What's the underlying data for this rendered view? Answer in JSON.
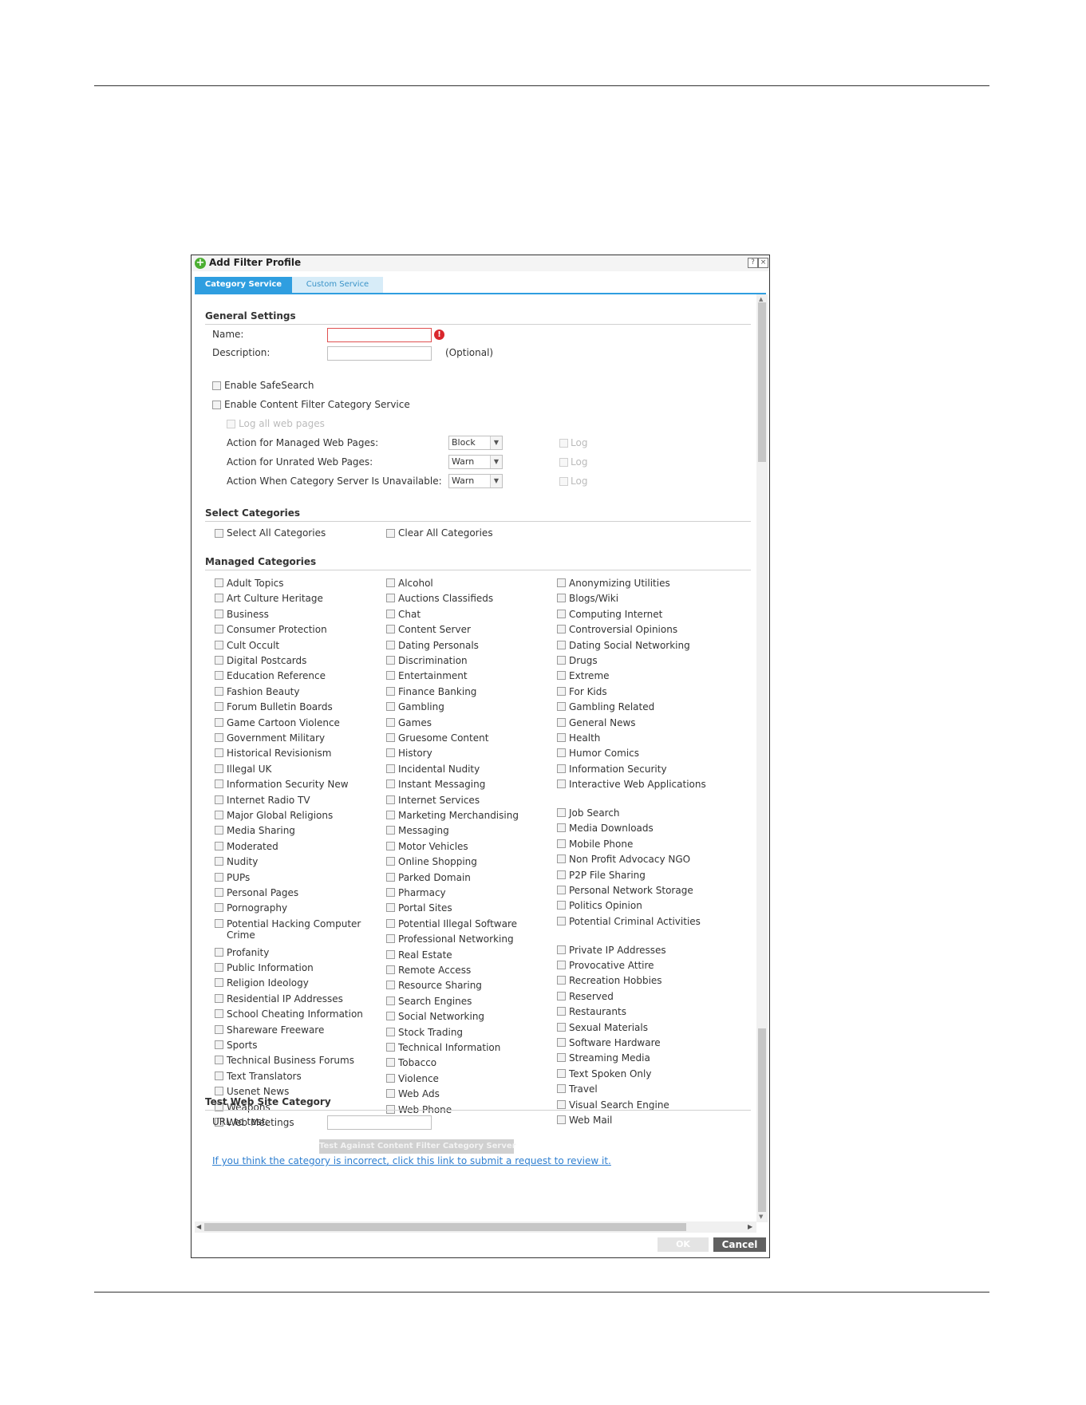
{
  "dialog": {
    "title": "Add Filter Profile",
    "help_glyph": "?",
    "close_glyph": "×",
    "tabs": [
      {
        "label": "Category Service",
        "active": true
      },
      {
        "label": "Custom Service",
        "active": false
      }
    ]
  },
  "general": {
    "heading": "General Settings",
    "name_label": "Name:",
    "name_value": "",
    "error_glyph": "!",
    "description_label": "Description:",
    "description_value": "",
    "optional_text": "(Optional)",
    "enable_safesearch": "Enable SafeSearch",
    "enable_content_filter": "Enable Content Filter Category Service",
    "log_all": "Log all web pages",
    "actions": [
      {
        "label": "Action for Managed Web Pages:",
        "value": "Block",
        "log": "Log"
      },
      {
        "label": "Action for Unrated Web Pages:",
        "value": "Warn",
        "log": "Log"
      },
      {
        "label": "Action When Category Server Is Unavailable:",
        "value": "Warn",
        "log": "Log"
      }
    ]
  },
  "select_categories": {
    "heading": "Select Categories",
    "select_all": "Select All Categories",
    "clear_all": "Clear All Categories"
  },
  "managed": {
    "heading": "Managed Categories",
    "columns": [
      [
        "Adult Topics",
        "Art Culture Heritage",
        "Business",
        "Consumer Protection",
        "Cult Occult",
        "Digital Postcards",
        "Education Reference",
        "Fashion Beauty",
        "Forum Bulletin Boards",
        "Game Cartoon Violence",
        "Government Military",
        "Historical Revisionism",
        "Illegal UK",
        "Information Security New",
        "Internet Radio TV",
        "Major Global Religions",
        "Media Sharing",
        "Moderated",
        "Nudity",
        "PUPs",
        "Personal Pages",
        "Pornography",
        "Potential Hacking Computer Crime",
        "Profanity",
        "Public Information",
        "Religion Ideology",
        "Residential IP Addresses",
        "School Cheating Information",
        "Shareware Freeware",
        "Sports",
        "Technical Business Forums",
        "Text Translators",
        "Usenet News",
        "Weapons",
        "Web Meetings"
      ],
      [
        "Alcohol",
        "Auctions Classifieds",
        "Chat",
        "Content Server",
        "Dating Personals",
        "Discrimination",
        "Entertainment",
        "Finance Banking",
        "Gambling",
        "Games",
        "Gruesome Content",
        "History",
        "Incidental Nudity",
        "Instant Messaging",
        "Internet Services",
        "Marketing Merchandising",
        "Messaging",
        "Motor Vehicles",
        "Online Shopping",
        "Parked Domain",
        "Pharmacy",
        "Portal Sites",
        "Potential Illegal Software",
        "Professional Networking",
        "Real Estate",
        "Remote Access",
        "Resource Sharing",
        "Search Engines",
        "Social Networking",
        "Stock Trading",
        "Technical Information",
        "Tobacco",
        "Violence",
        "Web Ads",
        "Web Phone"
      ],
      [
        "Anonymizing Utilities",
        "Blogs/Wiki",
        "Computing Internet",
        "Controversial Opinions",
        "Dating Social Networking",
        "Drugs",
        "Extreme",
        "For Kids",
        "Gambling Related",
        "General News",
        "Health",
        "Humor Comics",
        "Information Security",
        "Interactive Web Applications",
        "Job Search",
        "Media Downloads",
        "Mobile Phone",
        "Non Profit Advocacy NGO",
        "P2P File Sharing",
        "Personal Network Storage",
        "Politics Opinion",
        "Potential Criminal Activities",
        "Private IP Addresses",
        "Provocative Attire",
        "Recreation Hobbies",
        "Reserved",
        "Restaurants",
        "Sexual Materials",
        "Software Hardware",
        "Streaming Media",
        "Text Spoken Only",
        "Travel",
        "Visual Search Engine",
        "Web Mail"
      ]
    ]
  },
  "test": {
    "heading": "Test Web Site Category",
    "url_label": "URL to test:",
    "url_value": "",
    "button": "Test Against Content Filter Category Server",
    "link": "If you think the category is incorrect, click this link to submit a request to review it."
  },
  "footer": {
    "ok": "OK",
    "cancel": "Cancel"
  },
  "colors": {
    "tab_active": "#2f9ee0",
    "tab_inactive": "#d7ecf8",
    "link": "#2f7fd0",
    "error": "#d9262c",
    "cancel_button": "#606060"
  }
}
